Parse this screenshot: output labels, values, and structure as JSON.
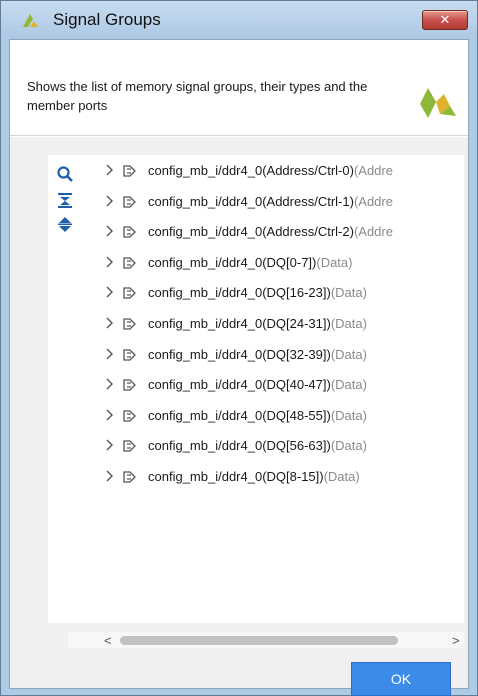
{
  "window": {
    "title": "Signal Groups",
    "close_label": "✕"
  },
  "header": {
    "description": "Shows the list of memory signal groups, their types and the member ports"
  },
  "toolbar": {
    "icons": [
      "search-icon",
      "collapse-all-icon",
      "expand-all-icon"
    ]
  },
  "tree": {
    "rows": [
      {
        "name": "config_mb_i/ddr4_0(Address/Ctrl-0)",
        "type": "(Addre"
      },
      {
        "name": "config_mb_i/ddr4_0(Address/Ctrl-1)",
        "type": "(Addre"
      },
      {
        "name": "config_mb_i/ddr4_0(Address/Ctrl-2)",
        "type": "(Addre"
      },
      {
        "name": "config_mb_i/ddr4_0(DQ[0-7])",
        "type": "(Data)"
      },
      {
        "name": "config_mb_i/ddr4_0(DQ[16-23])",
        "type": "(Data)"
      },
      {
        "name": "config_mb_i/ddr4_0(DQ[24-31])",
        "type": "(Data)"
      },
      {
        "name": "config_mb_i/ddr4_0(DQ[32-39])",
        "type": "(Data)"
      },
      {
        "name": "config_mb_i/ddr4_0(DQ[40-47])",
        "type": "(Data)"
      },
      {
        "name": "config_mb_i/ddr4_0(DQ[48-55])",
        "type": "(Data)"
      },
      {
        "name": "config_mb_i/ddr4_0(DQ[56-63])",
        "type": "(Data)"
      },
      {
        "name": "config_mb_i/ddr4_0(DQ[8-15])",
        "type": "(Data)"
      }
    ]
  },
  "scrollbar": {
    "left_arrow": "<",
    "right_arrow": ">"
  },
  "footer": {
    "ok_label": "OK"
  },
  "colors": {
    "accent": "#3c8be8",
    "title_bar": "#aecbe6",
    "logo_green": "#8fb83a",
    "logo_yellow": "#e0b12a"
  }
}
